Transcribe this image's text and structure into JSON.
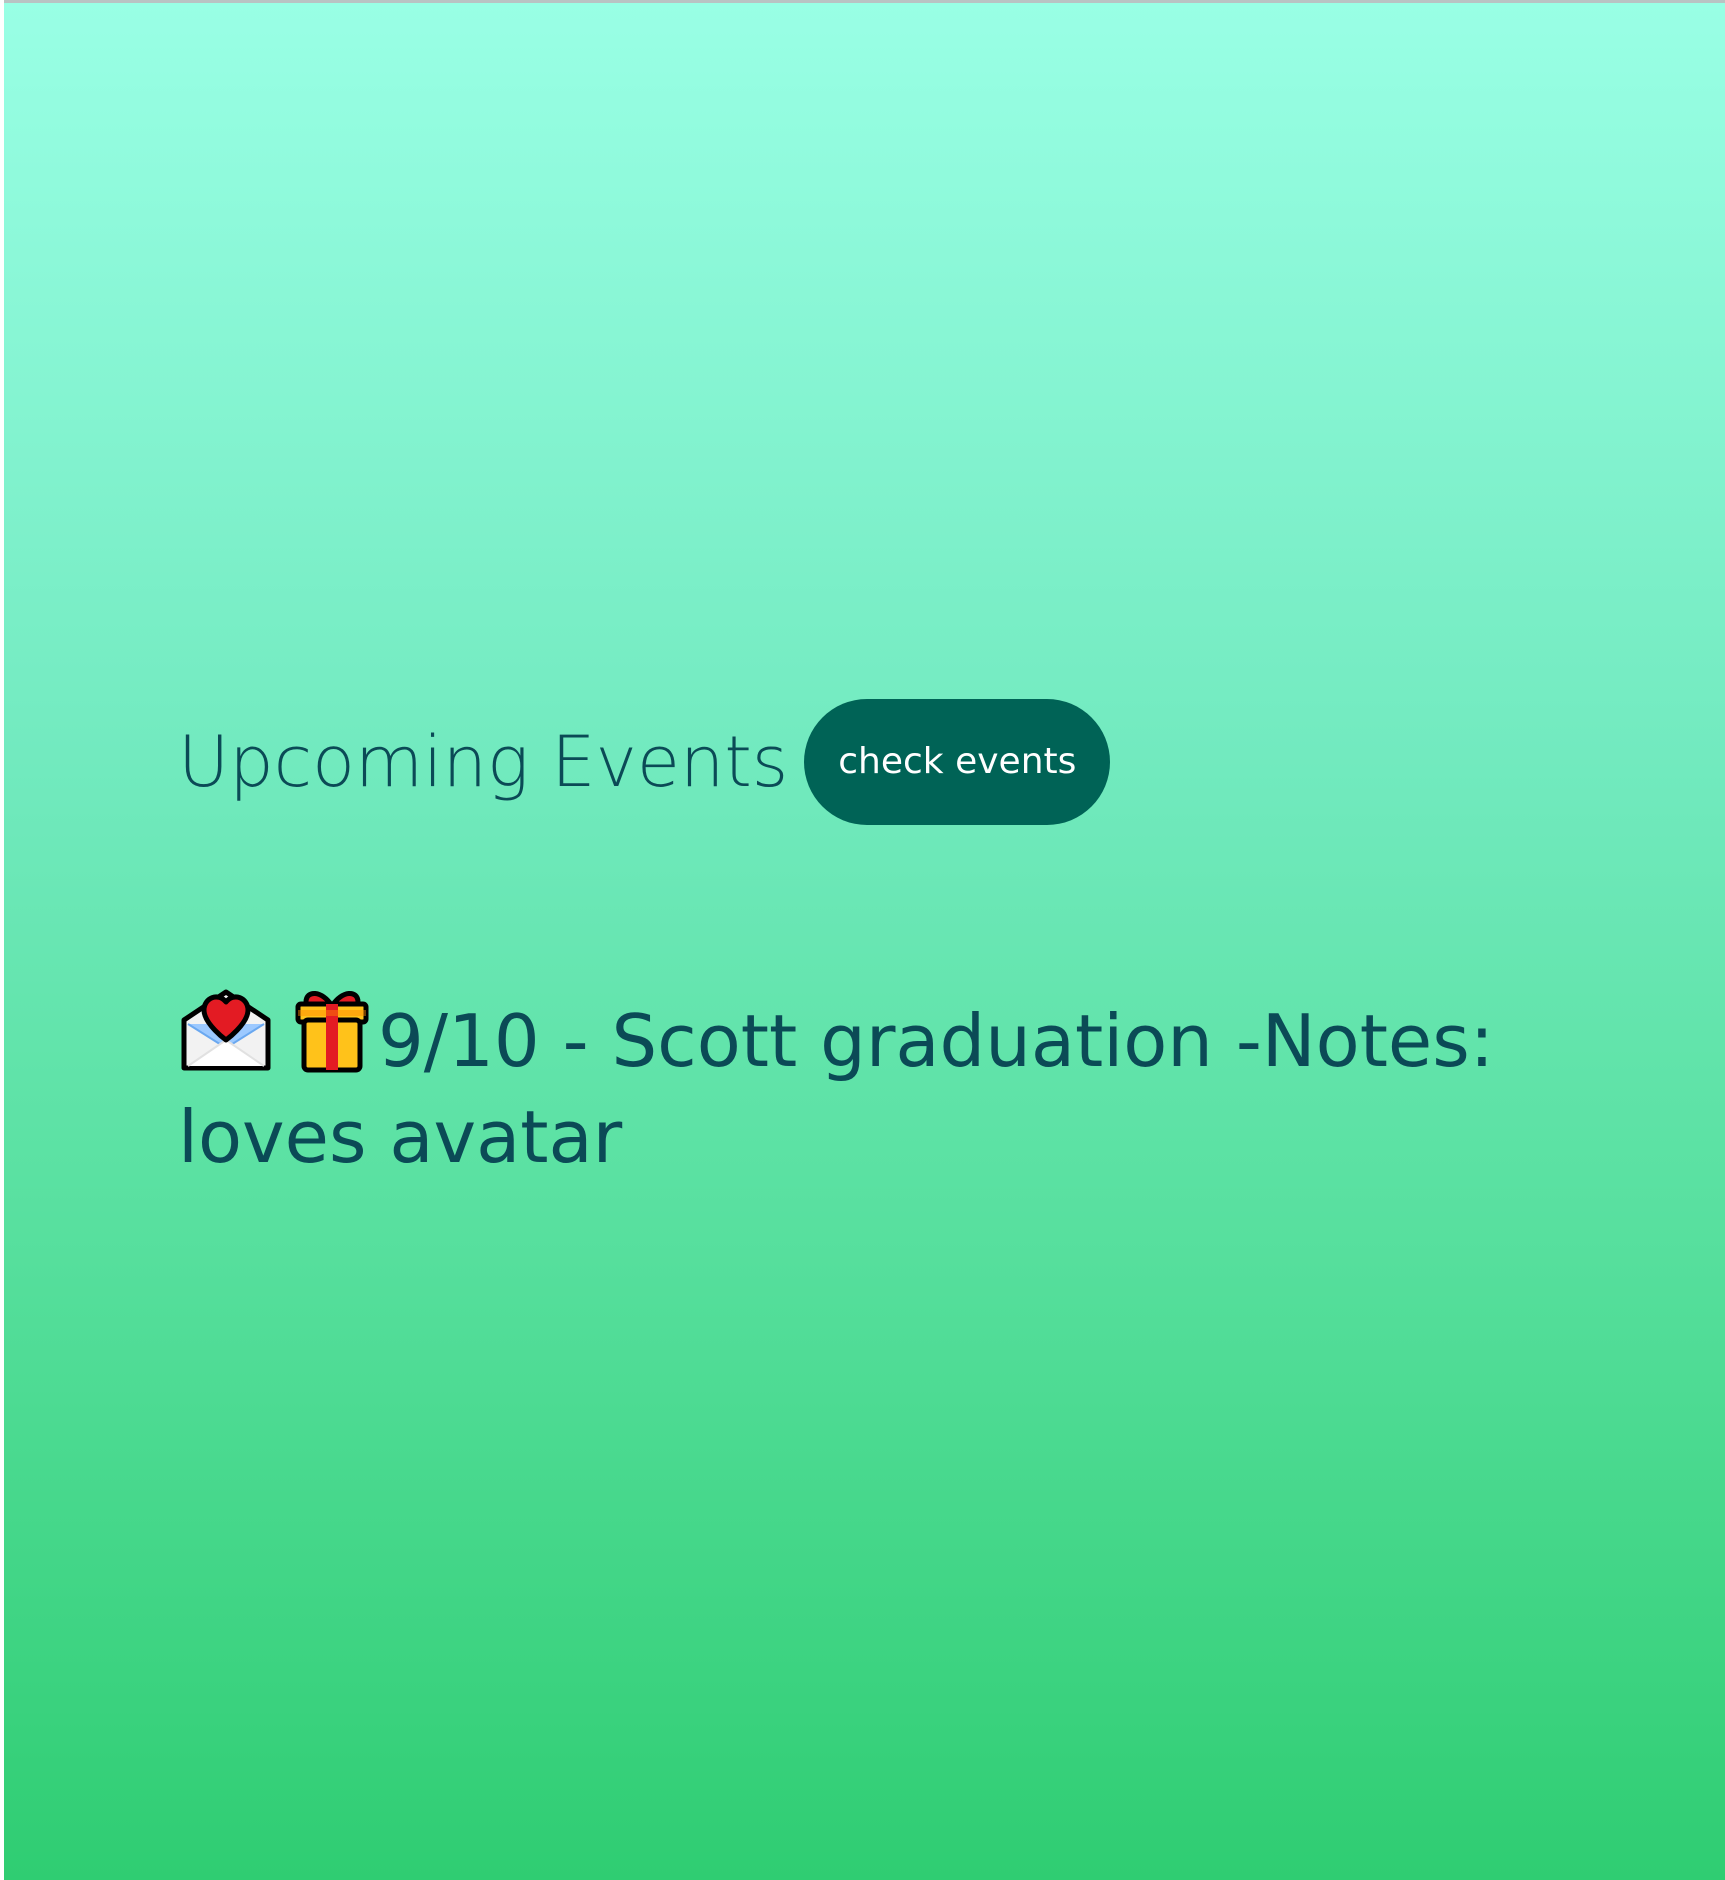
{
  "header": {
    "title": "Upcoming Events",
    "button_label": "check events"
  },
  "events": [
    {
      "icons": [
        "love-letter-icon",
        "gift-icon"
      ],
      "text": "9/10 - Scott graduation -Notes: loves avatar"
    }
  ],
  "colors": {
    "gradient_top": "#99ffe5",
    "gradient_bottom": "#2fcd72",
    "text": "#0b4a56",
    "button_bg": "#006356",
    "button_text": "#ffffff"
  }
}
